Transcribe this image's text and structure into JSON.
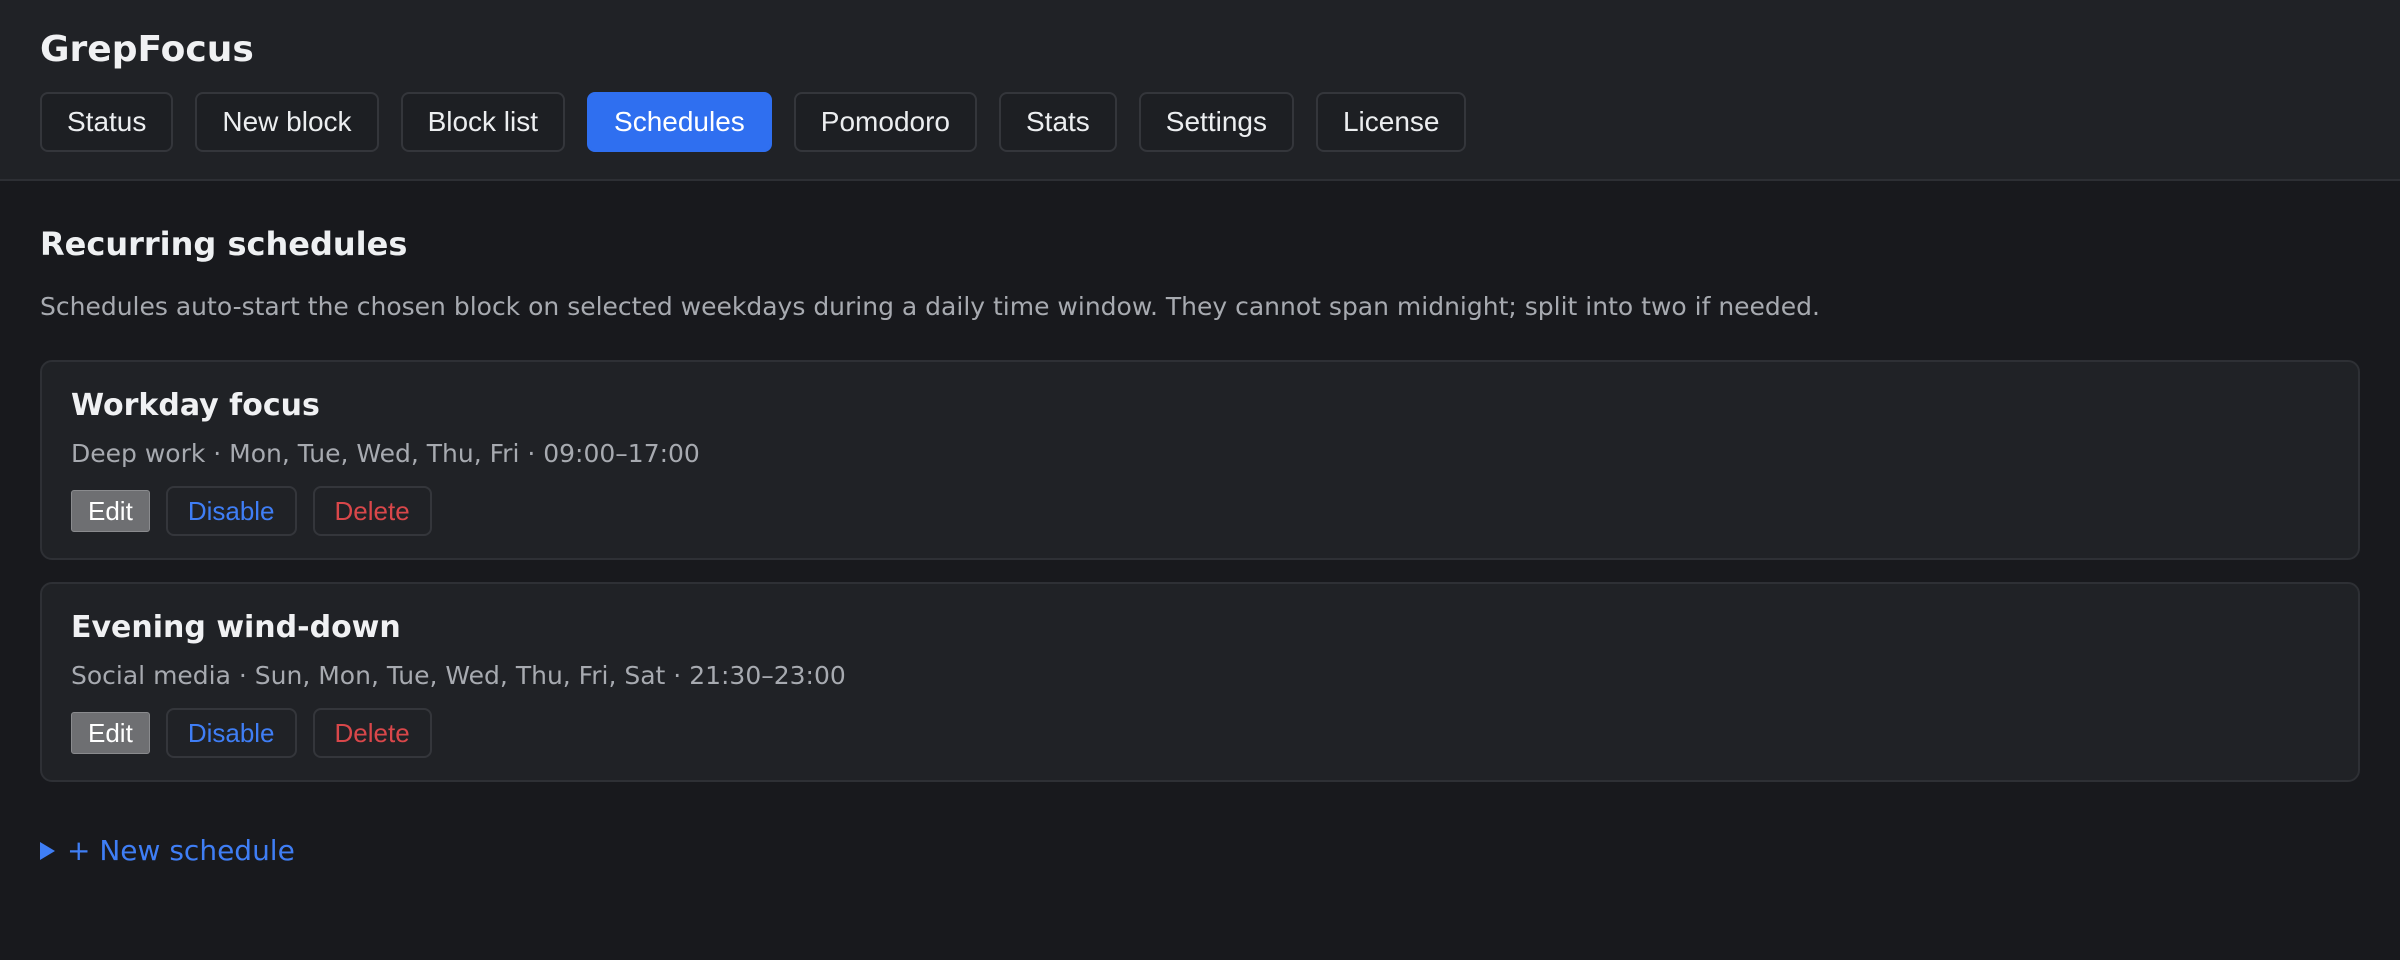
{
  "app": {
    "title": "GrepFocus"
  },
  "nav": {
    "tabs": [
      {
        "label": "Status"
      },
      {
        "label": "New block"
      },
      {
        "label": "Block list"
      },
      {
        "label": "Schedules",
        "active": true
      },
      {
        "label": "Pomodoro"
      },
      {
        "label": "Stats"
      },
      {
        "label": "Settings"
      },
      {
        "label": "License"
      }
    ]
  },
  "main": {
    "title": "Recurring schedules",
    "description": "Schedules auto-start the chosen block on selected weekdays during a daily time window. They cannot span midnight; split into two if needed.",
    "schedules": [
      {
        "name": "Workday focus",
        "meta": "Deep work · Mon, Tue, Wed, Thu, Fri · 09:00–17:00",
        "edit_label": "Edit",
        "disable_label": "Disable",
        "delete_label": "Delete"
      },
      {
        "name": "Evening wind-down",
        "meta": "Social media · Sun, Mon, Tue, Wed, Thu, Fri, Sat · 21:30–23:00",
        "edit_label": "Edit",
        "disable_label": "Disable",
        "delete_label": "Delete"
      }
    ],
    "new_schedule_label": "+ New schedule"
  },
  "colors": {
    "accent": "#2f6ff0",
    "link": "#3f7ef5",
    "danger": "#d9474a",
    "background": "#18191d",
    "surface": "#202226"
  },
  "icons": {
    "new_schedule": "disclosure-triangle-icon"
  }
}
